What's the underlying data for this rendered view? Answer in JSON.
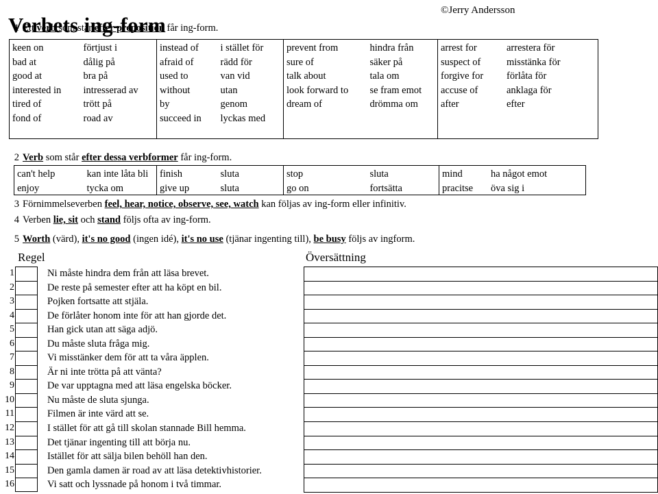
{
  "header": {
    "title": "Verbets ing-form",
    "copyright": "©Jerry Andersson"
  },
  "rules": [
    {
      "number": "1",
      "parts": [
        {
          "text": "Ett ",
          "style": "plain"
        },
        {
          "text": "verb",
          "style": "bold-underline"
        },
        {
          "text": " som står ",
          "style": "plain"
        },
        {
          "text": "efter  preposition",
          "style": "bold-underline"
        },
        {
          "text": " får ing-form.",
          "style": "plain"
        }
      ]
    },
    {
      "number": "2",
      "parts": [
        {
          "text": "Verb",
          "style": "bold-underline"
        },
        {
          "text": " som står ",
          "style": "plain"
        },
        {
          "text": "efter dessa verbformer",
          "style": "bold-underline"
        },
        {
          "text": " får ing-form.",
          "style": "plain"
        }
      ]
    },
    {
      "number": "3",
      "parts": [
        {
          "text": "Förnimmelseverben ",
          "style": "plain"
        },
        {
          "text": "feel, hear, notice, observe, see, watch",
          "style": "bold-underline"
        },
        {
          "text": " kan följas av ing-form eller infinitiv.",
          "style": "plain"
        }
      ]
    },
    {
      "number": "4",
      "parts": [
        {
          "text": "Verben ",
          "style": "plain"
        },
        {
          "text": "lie, sit",
          "style": "bold-underline"
        },
        {
          "text": " och ",
          "style": "plain"
        },
        {
          "text": "stand",
          "style": "bold-underline"
        },
        {
          "text": " följs ofta av ing-form.",
          "style": "plain"
        }
      ]
    },
    {
      "number": "5",
      "parts": [
        {
          "text": "Worth",
          "style": "bold-underline"
        },
        {
          "text": " (värd), ",
          "style": "plain"
        },
        {
          "text": "it's no good",
          "style": "bold-underline"
        },
        {
          "text": " (ingen idé), ",
          "style": "plain"
        },
        {
          "text": "it's no use",
          "style": "bold-underline"
        },
        {
          "text": " (tjänar ingenting till), ",
          "style": "plain"
        },
        {
          "text": "be busy",
          "style": "bold-underline"
        },
        {
          "text": " följs av ingform.",
          "style": "plain"
        }
      ]
    }
  ],
  "table1": {
    "groups": [
      {
        "english": [
          "keen on",
          "bad at",
          "good at",
          "interested in",
          "tired of",
          "fond of"
        ],
        "swedish": [
          "förtjust i",
          "dålig på",
          "bra på",
          "intresserad av",
          "trött på",
          "road av"
        ]
      },
      {
        "english": [
          "instead  of",
          "afraid of",
          "used to",
          "without",
          "by",
          "succeed in"
        ],
        "swedish": [
          "i stället för",
          "rädd för",
          "van vid",
          "utan",
          "genom",
          "lyckas med"
        ]
      },
      {
        "english": [
          "prevent from",
          "sure of",
          "talk about",
          "look forward to",
          "dream of",
          ""
        ],
        "swedish": [
          "hindra från",
          "säker på",
          "tala om",
          "se fram emot",
          "drömma om",
          ""
        ]
      },
      {
        "english": [
          "arrest for",
          "suspect of",
          "forgive for",
          "accuse of",
          "after",
          ""
        ],
        "swedish": [
          "arrestera för",
          "misstänka för",
          "förlåta för",
          "anklaga för",
          "efter",
          ""
        ]
      }
    ]
  },
  "table2": {
    "groups": [
      {
        "english": [
          "can't help",
          "enjoy"
        ],
        "swedish": [
          "kan inte låta bli",
          "tycka om"
        ]
      },
      {
        "english": [
          "finish",
          "give up"
        ],
        "swedish": [
          "sluta",
          "sluta"
        ]
      },
      {
        "english": [
          "stop",
          "go on"
        ],
        "swedish": [
          "sluta",
          "fortsätta"
        ]
      },
      {
        "english": [
          "mind",
          "pracitse"
        ],
        "swedish": [
          "ha något emot",
          "öva sig i"
        ]
      }
    ]
  },
  "exercise": {
    "regel_header": "Regel",
    "oversattning_header": "Översättning",
    "rows": [
      {
        "num": "1",
        "sentence": "Ni måste hindra dem från att läsa brevet.",
        "regel": "",
        "oversattning": ""
      },
      {
        "num": "2",
        "sentence": "De reste på semester efter att ha köpt en bil.",
        "regel": "",
        "oversattning": ""
      },
      {
        "num": "3",
        "sentence": "Pojken fortsatte att stjäla.",
        "regel": "",
        "oversattning": ""
      },
      {
        "num": "4",
        "sentence": "De förlåter honom inte för att han gjorde det.",
        "regel": "",
        "oversattning": ""
      },
      {
        "num": "5",
        "sentence": "Han gick utan att säga adjö.",
        "regel": "",
        "oversattning": ""
      },
      {
        "num": "6",
        "sentence": "Du måste sluta fråga mig.",
        "regel": "",
        "oversattning": ""
      },
      {
        "num": "7",
        "sentence": "Vi misstänker dem för att ta våra äpplen.",
        "regel": "",
        "oversattning": ""
      },
      {
        "num": "8",
        "sentence": "Är ni inte trötta på att vänta?",
        "regel": "",
        "oversattning": ""
      },
      {
        "num": "9",
        "sentence": "De var upptagna med att läsa engelska böcker.",
        "regel": "",
        "oversattning": ""
      },
      {
        "num": "10",
        "sentence": "Nu måste de sluta sjunga.",
        "regel": "",
        "oversattning": ""
      },
      {
        "num": "11",
        "sentence": "Filmen är inte värd att se.",
        "regel": "",
        "oversattning": ""
      },
      {
        "num": "12",
        "sentence": "I stället för att gå till skolan stannade Bill hemma.",
        "regel": "",
        "oversattning": ""
      },
      {
        "num": "13",
        "sentence": "Det tjänar ingenting till att börja nu.",
        "regel": "",
        "oversattning": ""
      },
      {
        "num": "14",
        "sentence": "Istället för att sälja bilen behöll han den.",
        "regel": "",
        "oversattning": ""
      },
      {
        "num": "15",
        "sentence": "Den gamla damen är road av att läsa detektivhistorier.",
        "regel": "",
        "oversattning": ""
      },
      {
        "num": "16",
        "sentence": "Vi satt och lyssnade på honom i två timmar.",
        "regel": "",
        "oversattning": ""
      }
    ]
  },
  "colors": {
    "text": "#000000",
    "background": "#ffffff",
    "border": "#000000"
  }
}
